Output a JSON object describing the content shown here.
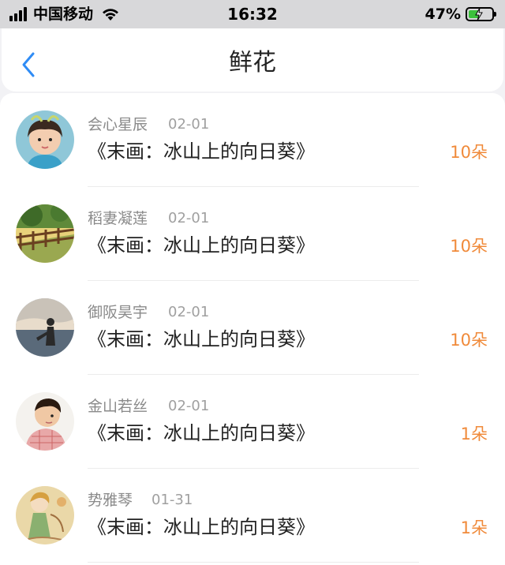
{
  "status_bar": {
    "carrier": "中国移动",
    "time": "16:32",
    "battery": "47%",
    "battery_level": 0.47,
    "battery_color": "#3cc13c"
  },
  "nav": {
    "title": "鲜花",
    "back_icon": "chevron-left-icon"
  },
  "colors": {
    "accent": "#f08a3a",
    "back": "#2f8cf5"
  },
  "items": [
    {
      "name": "会心星辰",
      "date": "02-01",
      "work": "《末画：冰山上的向日葵》",
      "count": "10朵",
      "avatar": "girl-portrait"
    },
    {
      "name": "稻妻凝莲",
      "date": "02-01",
      "work": "《末画：冰山上的向日葵》",
      "count": "10朵",
      "avatar": "fence-landscape"
    },
    {
      "name": "御阪昊宇",
      "date": "02-01",
      "work": "《末画：冰山上的向日葵》",
      "count": "10朵",
      "avatar": "beach-silhouette"
    },
    {
      "name": "金山若丝",
      "date": "02-01",
      "work": "《末画：冰山上的向日葵》",
      "count": "1朵",
      "avatar": "boy-portrait"
    },
    {
      "name": "势雅琴",
      "date": "01-31",
      "work": "《末画：冰山上的向日葵》",
      "count": "1朵",
      "avatar": "anime-illustration"
    }
  ]
}
